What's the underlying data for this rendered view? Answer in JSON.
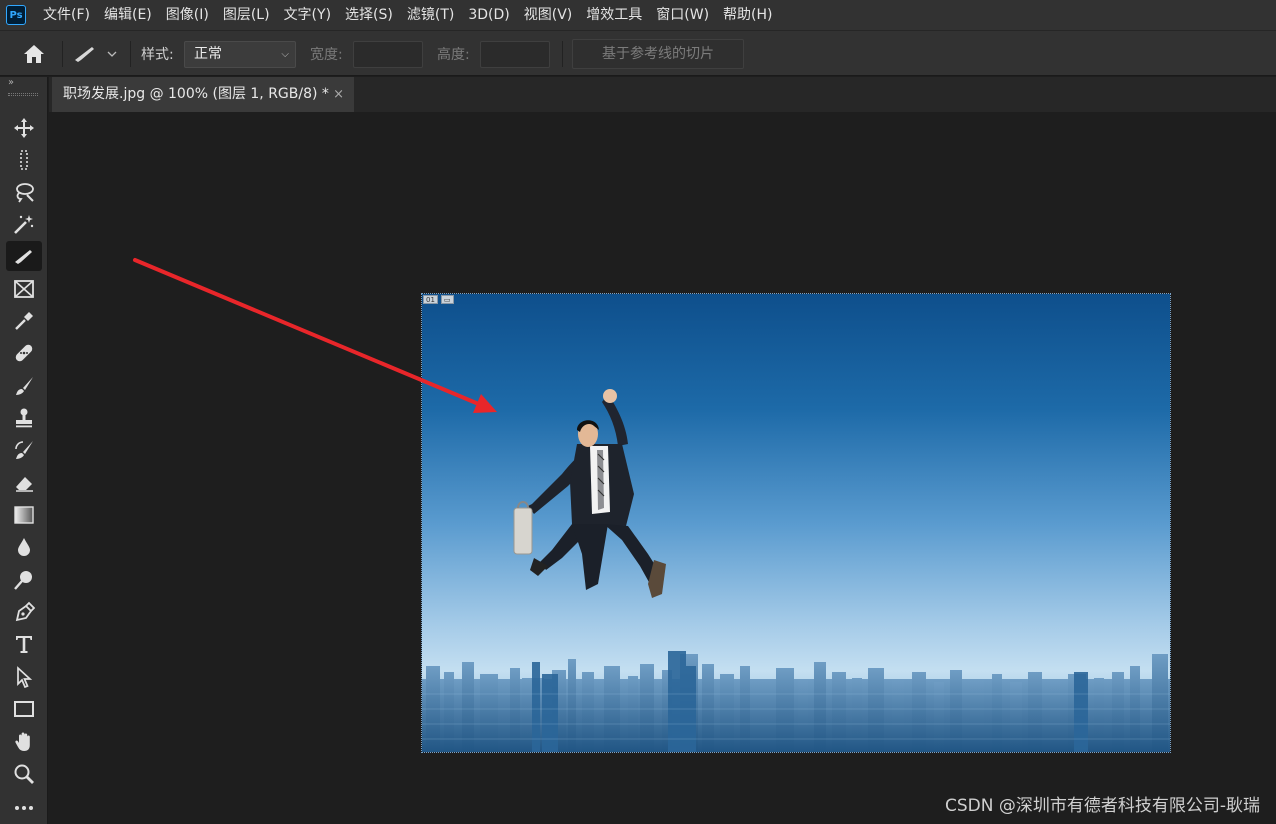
{
  "app": {
    "logo_text": "Ps"
  },
  "menubar": {
    "items": [
      "文件(F)",
      "编辑(E)",
      "图像(I)",
      "图层(L)",
      "文字(Y)",
      "选择(S)",
      "滤镜(T)",
      "3D(D)",
      "视图(V)",
      "增效工具",
      "窗口(W)",
      "帮助(H)"
    ]
  },
  "options": {
    "style_label": "样式:",
    "style_value": "正常",
    "width_label": "宽度:",
    "height_label": "高度:",
    "guides_button": "基于参考线的切片"
  },
  "document": {
    "tab_title": "职场发展.jpg @ 100% (图层 1, RGB/8) *",
    "close_glyph": "×",
    "layer_badges": [
      "01",
      "▭"
    ]
  },
  "tools": [
    {
      "icon": "move-icon"
    },
    {
      "icon": "marquee-icon"
    },
    {
      "icon": "lasso-icon"
    },
    {
      "icon": "magic-wand-icon"
    },
    {
      "icon": "slice-icon",
      "active": true
    },
    {
      "icon": "frame-icon"
    },
    {
      "icon": "eyedropper-icon"
    },
    {
      "icon": "healing-brush-icon"
    },
    {
      "icon": "brush-icon"
    },
    {
      "icon": "clone-stamp-icon"
    },
    {
      "icon": "history-brush-icon"
    },
    {
      "icon": "eraser-icon"
    },
    {
      "icon": "gradient-icon"
    },
    {
      "icon": "blur-icon"
    },
    {
      "icon": "dodge-icon"
    },
    {
      "icon": "pen-icon"
    },
    {
      "icon": "type-icon"
    },
    {
      "icon": "path-selection-icon"
    },
    {
      "icon": "rectangle-icon"
    },
    {
      "icon": "hand-icon"
    },
    {
      "icon": "zoom-icon"
    },
    {
      "icon": "more-tools-icon"
    }
  ],
  "colors": {
    "annotation_arrow": "#e8262a",
    "sky_top": "#0e4f8c",
    "sky_horizon": "#bcd9ee",
    "app_chrome": "#323232"
  },
  "watermark": "CSDN @深圳市有德者科技有限公司-耿瑞"
}
